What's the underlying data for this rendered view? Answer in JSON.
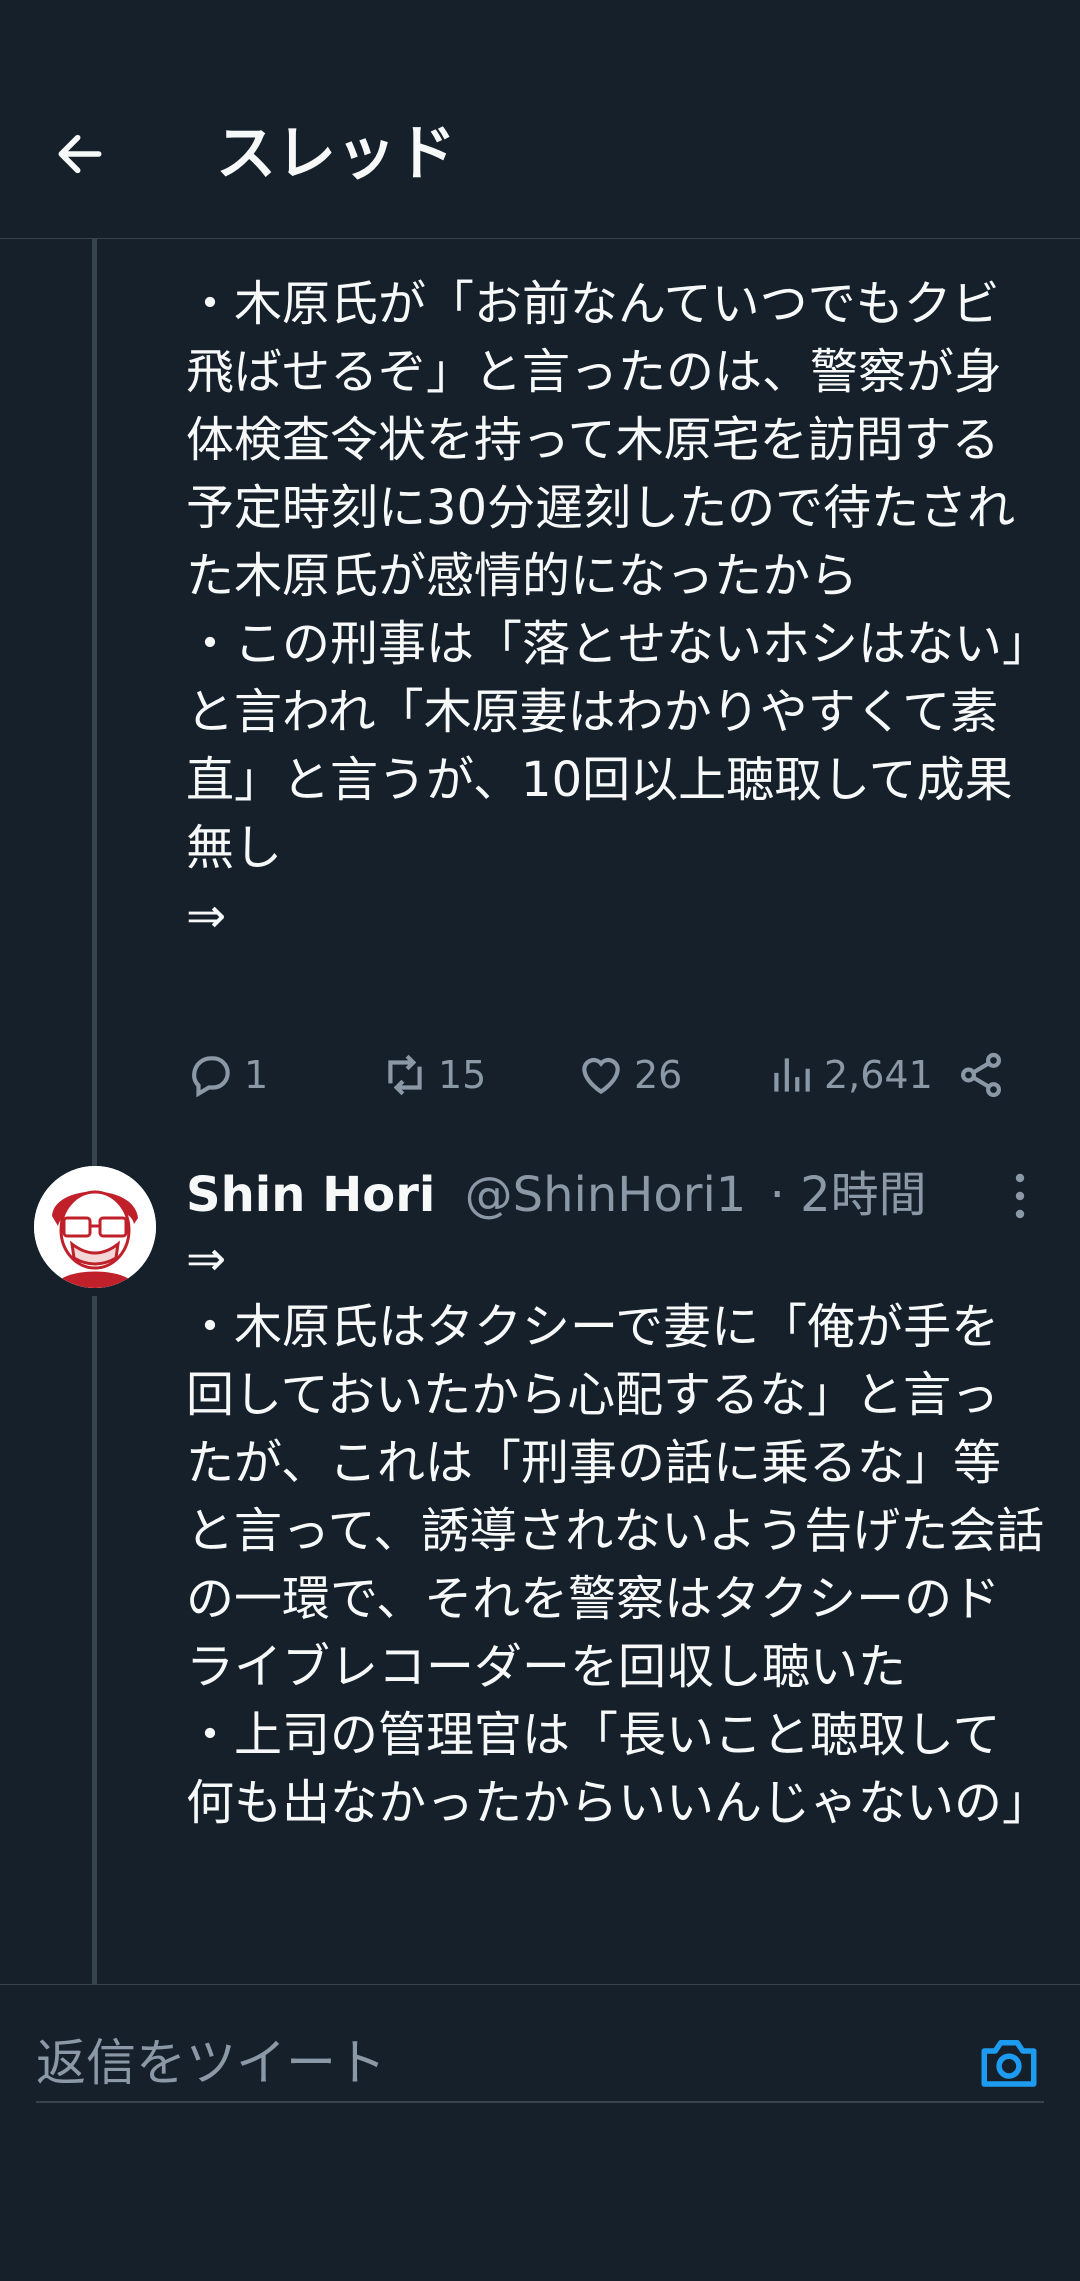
{
  "header": {
    "title": "スレッド"
  },
  "tweet1": {
    "text": "・木原氏が「お前なんていつでもクビ飛ばせるぞ」と言ったのは、警察が身体検査令状を持って木原宅を訪問する予定時刻に30分遅刻したので待たされた木原氏が感情的になったから\n・この刑事は「落とせないホシはない」と言われ「木原妻はわかりやすくて素直」と言うが、10回以上聴取して成果無し\n⇒",
    "replies": "1",
    "retweets": "15",
    "likes": "26",
    "views": "2,641"
  },
  "tweet2": {
    "name": "Shin Hori",
    "handle": "@ShinHori1",
    "time": "· 2時間",
    "text": "⇒\n・木原氏はタクシーで妻に「俺が手を回しておいたから心配するな」と言ったが、これは「刑事の話に乗るな」等と言って、誘導されないよう告げた会話の一環で、それを警察はタクシーのドライブレコーダーを回収し聴いた\n・上司の管理官は「長いこと聴取して何も出なかったからいいんじゃないの」"
  },
  "reply": {
    "placeholder": "返信をツイート"
  },
  "colors": {
    "background": "#15202b",
    "accent": "#1d9bf0",
    "muted": "#8b98a5",
    "divider": "#38444d"
  },
  "icons": [
    "back-arrow-icon",
    "reply-icon",
    "retweet-icon",
    "like-icon",
    "views-icon",
    "share-icon",
    "more-icon",
    "camera-icon"
  ]
}
